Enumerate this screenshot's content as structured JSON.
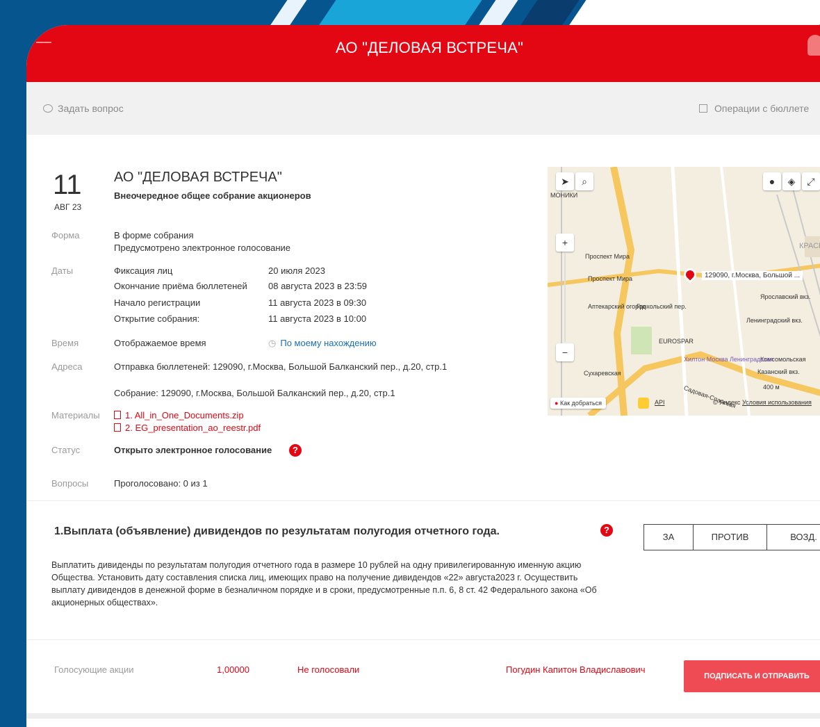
{
  "header": {
    "title": "АО \"ДЕЛОВАЯ ВСТРЕЧА\""
  },
  "toolbar": {
    "ask": "Задать вопрос",
    "ops": "Операции с бюллете"
  },
  "meeting": {
    "day": "11",
    "month_year": "АВГ 23",
    "org": "АО \"ДЕЛОВАЯ ВСТРЕЧА\"",
    "type": "Внеочередное общее собрание акционеров",
    "form_label": "Форма",
    "form_lines": [
      "В форме собрания",
      "Предусмотрено электронное голосование"
    ],
    "dates_label": "Даты",
    "dates": [
      {
        "name": "Фиксация лиц",
        "value": "20 июля 2023"
      },
      {
        "name": "Окончание приёма бюллетеней",
        "value": "08 августа 2023 в 23:59"
      },
      {
        "name": "Начало регистрации",
        "value": "11 августа 2023 в 09:30"
      },
      {
        "name": "Открытие собрания:",
        "value": "11 августа 2023 в 10:00"
      }
    ],
    "time_label": "Время",
    "time_text": "Отображаемое время",
    "time_link": "По моему нахождению",
    "address_label": "Адреса",
    "address_send": "Отправка бюллетеней: 129090, г.Москва, Большой Балканский пер., д.20, стр.1",
    "address_meeting": "Собрание: 129090, г.Москва, Большой Балканский пер., д.20, стр.1",
    "materials_label": "Материалы",
    "materials": [
      "1. All_in_One_Documents.zip",
      "2. EG_presentation_ao_reestr.pdf"
    ],
    "status_label": "Статус",
    "status_value": "Открыто электронное голосование",
    "questions_label": "Вопросы",
    "questions_value": "Проголосовано: 0 из 1"
  },
  "map": {
    "address_pin": "129090, г.Москва, Большой ...",
    "labels": [
      "Проспект Мира",
      "Проспект Мира",
      "Сухаревская",
      "Комсомольская",
      "EUROSPAR",
      "Хилтон Москва Ленинградская",
      "Ярославский вкз.",
      "Ленинградский вкз.",
      "Казанский вкз.",
      "Аптекарский огород",
      "Грохольский пер.",
      "Садовая-Спасская",
      "КРАСНО",
      "МОНИКИ"
    ],
    "route": "Как добраться",
    "api": "API",
    "copyright": "© Яндекс",
    "terms": "Условия использования",
    "scale": "400 м"
  },
  "question": {
    "title": "1.Выплата (объявление) дивидендов по результатам полугодия отчетного года.",
    "body": "Выплатить дивиденды по результатам полугодия отчетного года в размере 10 рублей на одну привилегированную именную акцию Общества. Установить дату составления списка лиц, имеющих право на получение дивидендов «22» августа2023 г. Осуществить выплату дивидендов в денежной форме в безналичном порядке и в сроки, предусмотренные п.п. 6, 8 ст. 42 Федерального закона «Об акционерных обществах».",
    "votes": [
      "ЗА",
      "ПРОТИВ",
      "ВОЗД."
    ]
  },
  "footer": {
    "shares_label": "Голосующие акции",
    "shares_value": "1,00000",
    "vote_status": "Не голосовали",
    "person": "Погудин Капитон Владиславович",
    "sign_button": "ПОДПИСАТЬ И ОТПРАВИТЬ"
  },
  "colors": {
    "brand_red": "#e30613",
    "frame_blue": "#07558f",
    "link_blue": "#1c6fb5"
  }
}
